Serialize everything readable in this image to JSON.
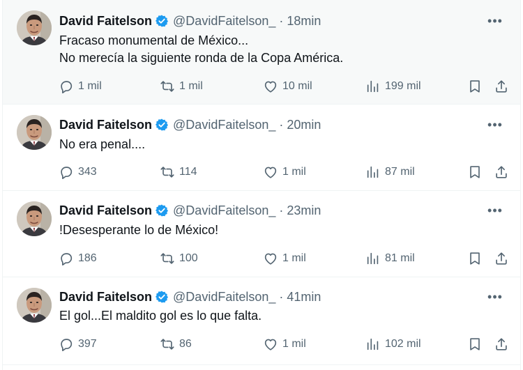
{
  "tweets": [
    {
      "author_name": "David Faitelson",
      "handle": "@DavidFaitelson_",
      "separator": "·",
      "time": "18min",
      "lines": [
        "Fracaso monumental de México...",
        "No merecía la siguiente ronda de la Copa América."
      ],
      "replies": "1 mil",
      "retweets": "1 mil",
      "likes": "10 mil",
      "views": "199 mil"
    },
    {
      "author_name": "David Faitelson",
      "handle": "@DavidFaitelson_",
      "separator": "·",
      "time": "20min",
      "lines": [
        "No era penal...."
      ],
      "replies": "343",
      "retweets": "114",
      "likes": "1 mil",
      "views": "87 mil"
    },
    {
      "author_name": "David Faitelson",
      "handle": "@DavidFaitelson_",
      "separator": "·",
      "time": "23min",
      "lines": [
        "!Desesperante lo de México!"
      ],
      "replies": "186",
      "retweets": "100",
      "likes": "1 mil",
      "views": "81 mil"
    },
    {
      "author_name": "David Faitelson",
      "handle": "@DavidFaitelson_",
      "separator": "·",
      "time": "41min",
      "lines": [
        "El gol...El maldito gol es lo que falta."
      ],
      "replies": "397",
      "retweets": "86",
      "likes": "1 mil",
      "views": "102 mil"
    }
  ],
  "icons": {
    "more": "more-horizontal-icon",
    "verified": "verified-badge-icon",
    "reply": "reply-bubble-icon",
    "retweet": "retweet-icon",
    "like": "heart-icon",
    "views": "views-bar-chart-icon",
    "bookmark": "bookmark-icon",
    "share": "share-upload-icon"
  },
  "colors": {
    "accent": "#1d9bf0",
    "text": "#0f1419",
    "secondary": "#536471",
    "highlight_bg": "#f7f9f9",
    "divider": "#eff3f4"
  }
}
